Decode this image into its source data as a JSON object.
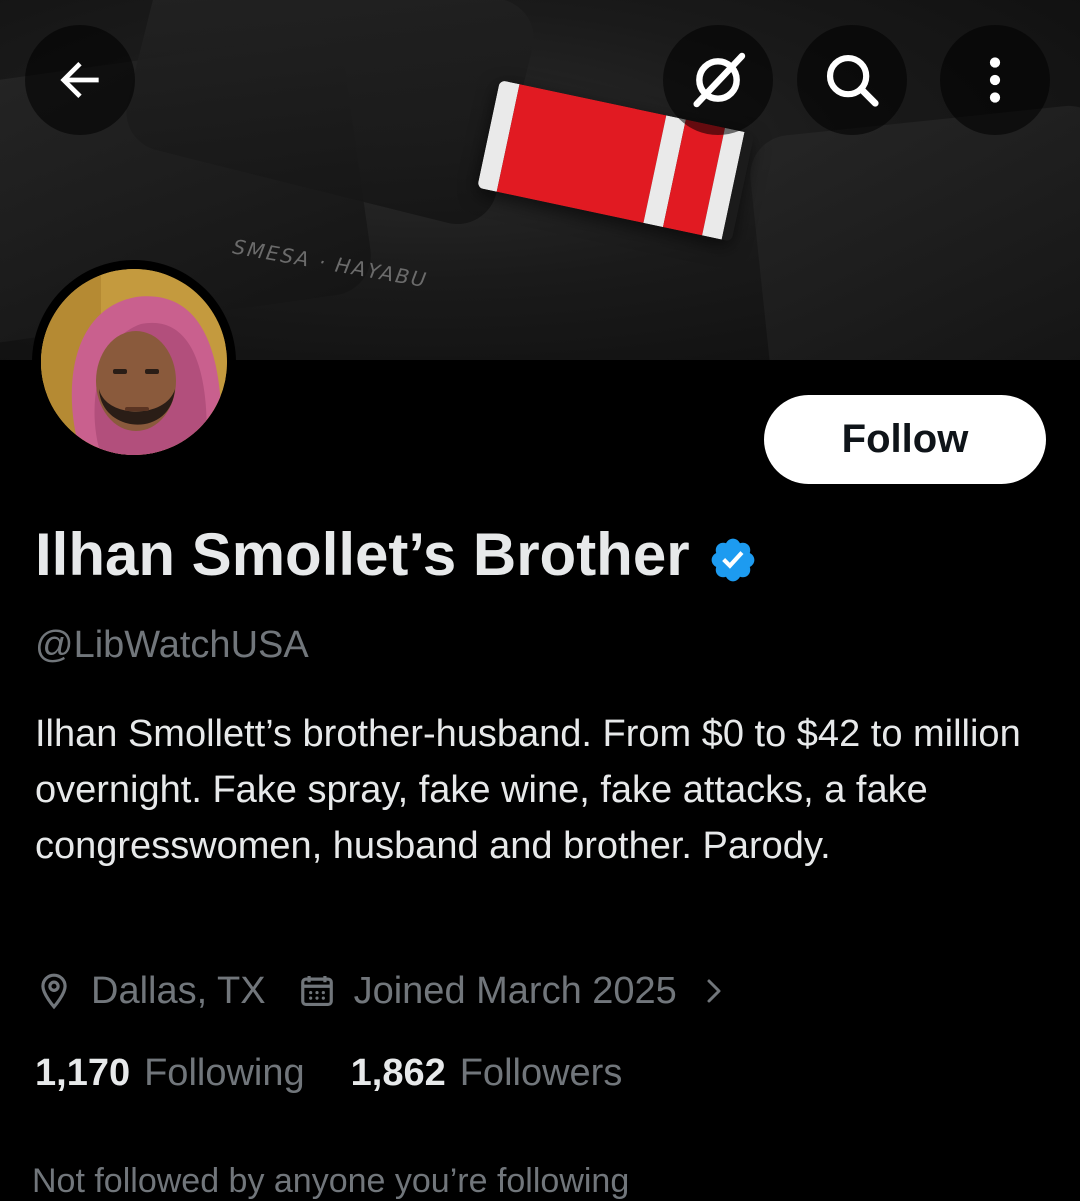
{
  "header": {
    "back_icon": "back-arrow-icon",
    "grok_icon": "grok-slash-icon",
    "search_icon": "search-icon",
    "more_icon": "more-vertical-icon"
  },
  "banner": {
    "stitch_text": "SMESA · HAYABU"
  },
  "profile": {
    "display_name": "Ilhan Smollet’s Brother",
    "verified": true,
    "verified_color": "#1d9bf0",
    "handle": "@LibWatchUSA",
    "bio": "Ilhan Smollett’s brother-husband. From $0 to $42 to million overnight. Fake spray, fake wine, fake attacks, a fake congresswomen, husband and brother. Parody.",
    "location": "Dallas, TX",
    "joined": "Joined March 2025",
    "follow_label": "Follow",
    "following_count": "1,170",
    "following_label": "Following",
    "followers_count": "1,862",
    "followers_label": "Followers",
    "not_followed_text": "Not followed by anyone you’re following"
  },
  "colors": {
    "background": "#000000",
    "text_primary": "#e7e9ea",
    "text_secondary": "#71767b",
    "follow_bg": "#ffffff",
    "follow_text": "#0f1419"
  }
}
